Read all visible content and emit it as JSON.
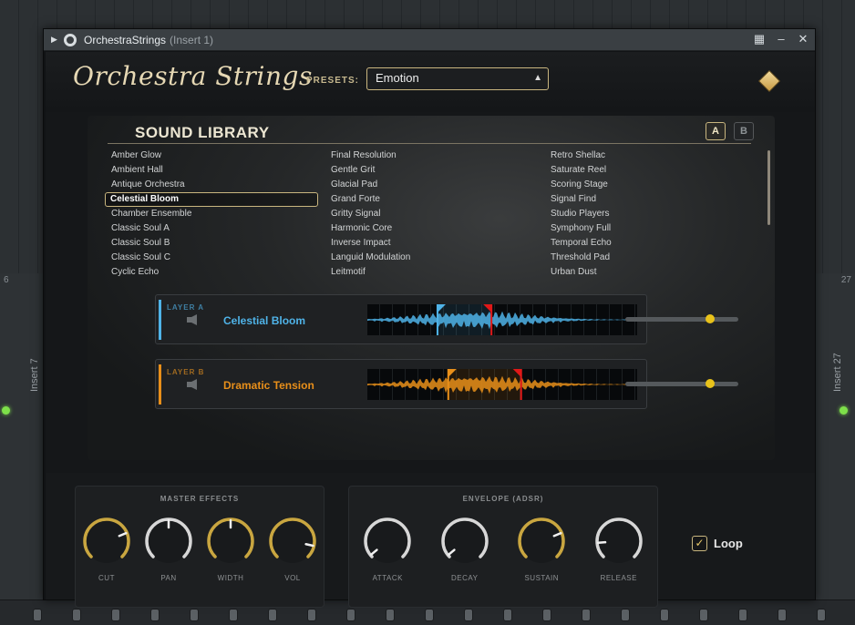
{
  "host": {
    "left_number": "6",
    "right_number": "27",
    "left_insert_label": "Insert 7",
    "right_insert_label": "Insert 27"
  },
  "window": {
    "title": "OrchestraStrings",
    "subtitle": "(Insert 1)",
    "icons": [
      "expand-arrow-icon",
      "gear-icon",
      "grid-icon",
      "minimize-icon",
      "close-icon"
    ]
  },
  "header": {
    "logo": "Orchestra Strings",
    "presets_label": "PRESETS:",
    "preset_value": "Emotion"
  },
  "library": {
    "title": "SOUND LIBRARY",
    "tab_a": "A",
    "tab_b": "B",
    "columns": [
      [
        "Amber Glow",
        "Ambient Hall",
        "Antique Orchestra",
        "Celestial Bloom",
        "Chamber Ensemble",
        "Classic Soul A",
        "Classic Soul B",
        "Classic Soul C",
        "Cyclic Echo"
      ],
      [
        "Final Resolution",
        "Gentle Grit",
        "Glacial Pad",
        "Grand Forte",
        "Gritty Signal",
        "Harmonic Core",
        "Inverse Impact",
        "Languid Modulation",
        "Leitmotif"
      ],
      [
        "Retro Shellac",
        "Saturate Reel",
        "Scoring Stage",
        "Signal Find",
        "Studio Players",
        "Symphony Full",
        "Temporal Echo",
        "Threshold Pad",
        "Urban Dust"
      ]
    ],
    "selected": "Celestial Bloom"
  },
  "layers": [
    {
      "tag": "LAYER A",
      "name": "Celestial Bloom",
      "color": "#4fb3e8",
      "start": 0.26,
      "end": 0.46,
      "volume": 0.75
    },
    {
      "tag": "LAYER B",
      "name": "Dramatic Tension",
      "color": "#e88f1a",
      "start": 0.3,
      "end": 0.57,
      "volume": 0.75
    }
  ],
  "master_effects": {
    "title": "MASTER EFFECTS",
    "knobs": [
      {
        "label": "CUT",
        "value": 0.75,
        "color": "#c9a640"
      },
      {
        "label": "PAN",
        "value": 0.5,
        "color": "#d7d7d7"
      },
      {
        "label": "WIDTH",
        "value": 0.5,
        "color": "#c9a640"
      },
      {
        "label": "VOL",
        "value": 0.88,
        "color": "#c9a640"
      }
    ]
  },
  "envelope": {
    "title": "ENVELOPE (ADSR)",
    "knobs": [
      {
        "label": "ATTACK",
        "value": 0.02,
        "color": "#d7d7d7"
      },
      {
        "label": "DECAY",
        "value": 0.02,
        "color": "#d7d7d7"
      },
      {
        "label": "SUSTAIN",
        "value": 0.75,
        "color": "#c9a640"
      },
      {
        "label": "RELEASE",
        "value": 0.15,
        "color": "#d7d7d7"
      }
    ]
  },
  "loop": {
    "label": "Loop",
    "checked": true
  }
}
